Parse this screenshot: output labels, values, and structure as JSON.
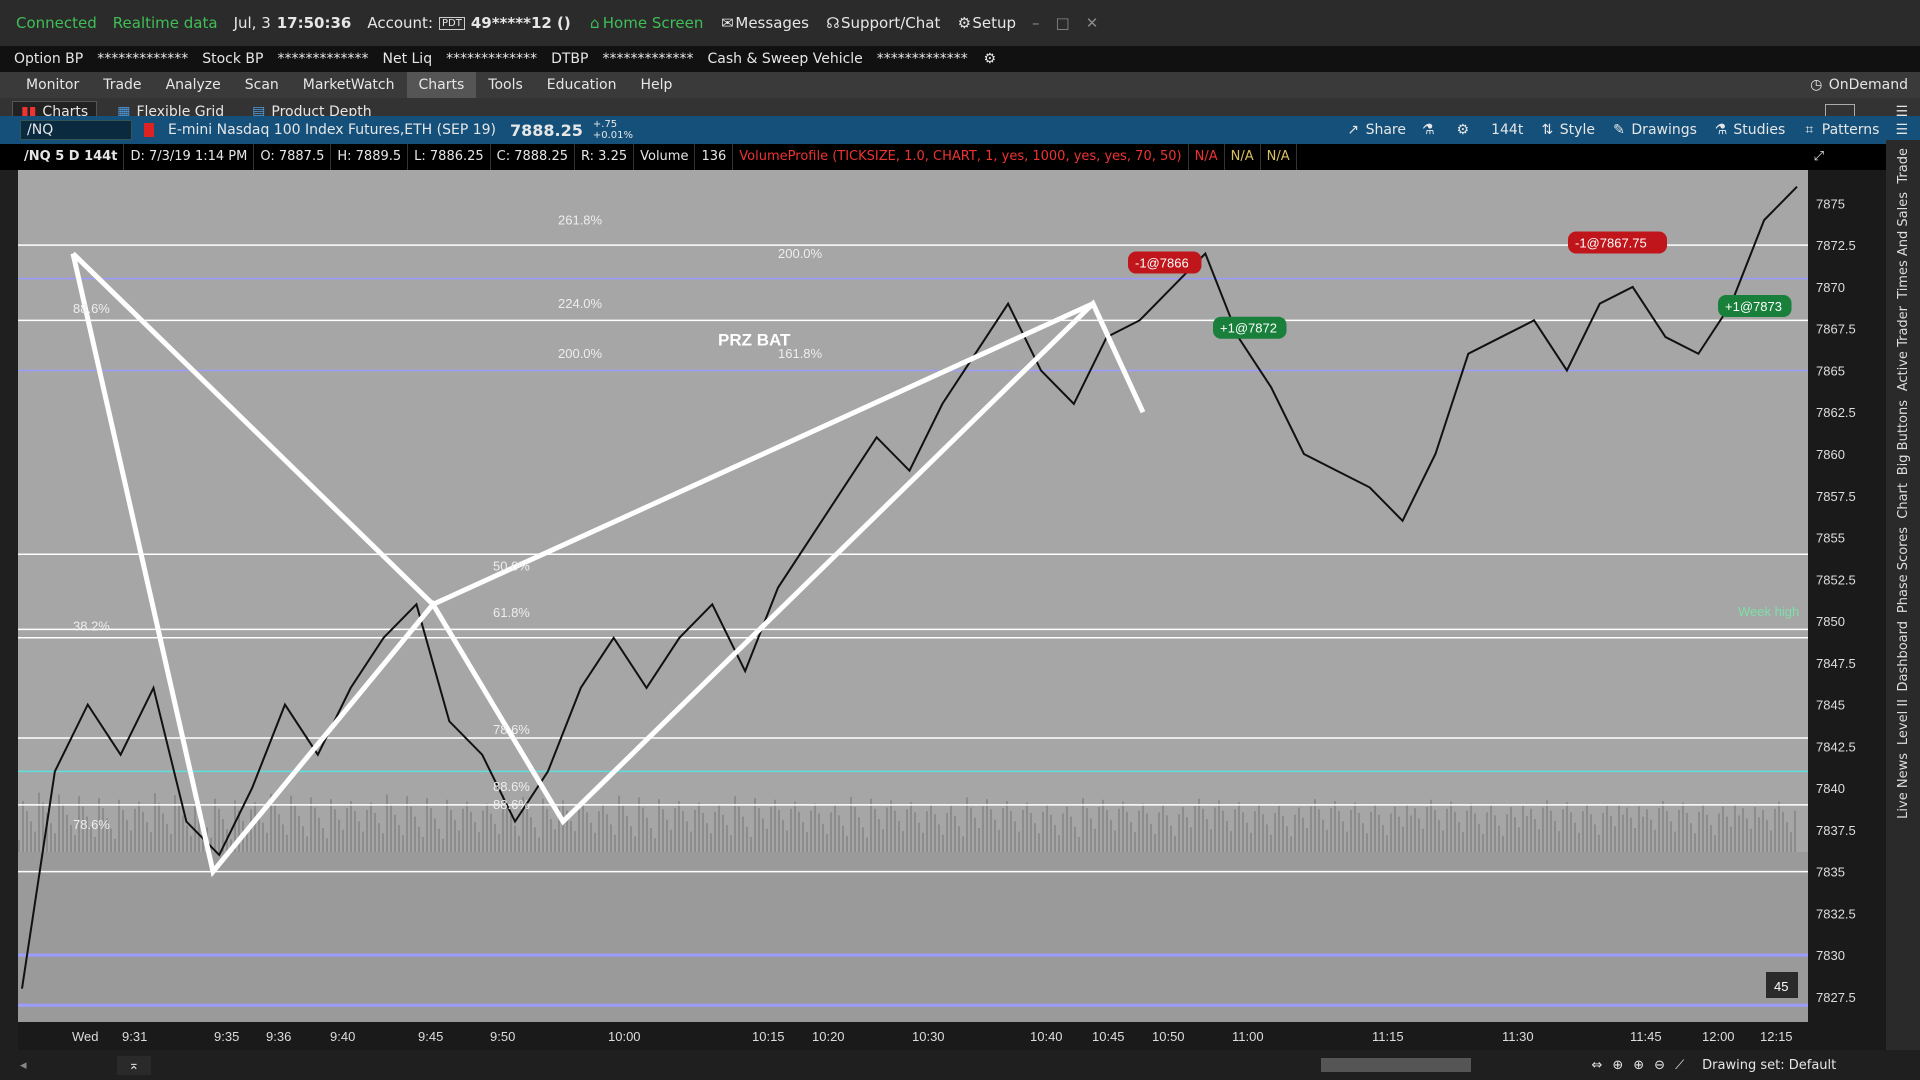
{
  "status": {
    "connected": "Connected",
    "realtime": "Realtime data",
    "date": "Jul, 3",
    "time": "17:50:36",
    "account_label": "Account:",
    "account_badge": "PDT",
    "account_value": "49*****12 ()",
    "home": "Home Screen",
    "messages": "Messages",
    "support": "Support/Chat",
    "setup": "Setup"
  },
  "account_bar": {
    "option_bp": "Option BP",
    "option_bp_val": "*************",
    "stock_bp": "Stock BP",
    "stock_bp_val": "*************",
    "net_liq": "Net Liq",
    "net_liq_val": "*************",
    "dtbp": "DTBP",
    "dtbp_val": "*************",
    "cash": "Cash & Sweep Vehicle",
    "cash_val": "*************"
  },
  "menu": {
    "items": [
      "Monitor",
      "Trade",
      "Analyze",
      "Scan",
      "MarketWatch",
      "Charts",
      "Tools",
      "Education",
      "Help"
    ],
    "ondemand": "OnDemand"
  },
  "subtabs": [
    "Charts",
    "Flexible Grid",
    "Product Depth"
  ],
  "symbol_bar": {
    "symbol": "/NQ",
    "description": "E-mini Nasdaq 100 Index Futures,ETH (SEP 19)",
    "last": "7888.25",
    "change": "+.75",
    "change_pct": "+0.01%",
    "share": "Share",
    "aggregation": "144t",
    "style": "Style",
    "drawings": "Drawings",
    "studies": "Studies",
    "patterns": "Patterns"
  },
  "info_bar": {
    "head": "/NQ 5 D 144t",
    "date": "D: 7/3/19 1:14 PM",
    "open": "O: 7887.5",
    "high": "H: 7889.5",
    "low": "L: 7886.25",
    "close": "C: 7888.25",
    "range": "R: 3.25",
    "volume_label": "Volume",
    "volume_val": "136",
    "vp": "VolumeProfile (TICKSIZE, 1.0, CHART, 1, yes, 1000, yes, yes, 70, 50)",
    "na1": "N/A",
    "na2": "N/A",
    "na3": "N/A"
  },
  "chart_data": {
    "type": "line",
    "title": "",
    "ylim": [
      7826,
      7877
    ],
    "y_ticks": [
      "7875",
      "7872.5",
      "7870",
      "7867.5",
      "7865",
      "7862.5",
      "7860",
      "7857.5",
      "7855",
      "7852.5",
      "7850",
      "7847.5",
      "7845",
      "7842.5",
      "7840",
      "7837.5",
      "7835",
      "7832.5",
      "7830",
      "7827.5"
    ],
    "x_ticks": [
      "Wed",
      "9:31",
      "9:35",
      "9:36",
      "9:40",
      "9:45",
      "9:50",
      "10:00",
      "10:15",
      "10:20",
      "10:30",
      "10:40",
      "10:45",
      "10:50",
      "11:00",
      "11:15",
      "11:30",
      "11:45",
      "12:00",
      "12:15"
    ],
    "fib_labels": [
      "261.8%",
      "200.0%",
      "224.0%",
      "200.0%",
      "161.8%",
      "88.6%",
      "50.0%",
      "61.8%",
      "38.2%",
      "78.6%",
      "78.6%",
      "88.6%",
      "88.6%"
    ],
    "pattern_label": "PRZ BAT",
    "week_high": "Week high",
    "trades": [
      "-1@7866",
      "+1@7872",
      "-1@7867.75",
      "+1@7873"
    ],
    "price_series": [
      7828,
      7841,
      7845,
      7842,
      7846,
      7838,
      7836,
      7840,
      7845,
      7842,
      7846,
      7849,
      7851,
      7844,
      7842,
      7838,
      7841,
      7846,
      7849,
      7846,
      7849,
      7851,
      7847,
      7852,
      7855,
      7858,
      7861,
      7859,
      7863,
      7866,
      7869,
      7865,
      7863,
      7867,
      7868,
      7870,
      7872,
      7867,
      7864,
      7860,
      7859,
      7858,
      7856,
      7860,
      7866,
      7867,
      7868,
      7865,
      7869,
      7870,
      7867,
      7866,
      7869,
      7874,
      7876
    ],
    "harmonic_points": [
      7872,
      7835,
      7851,
      7838,
      7869,
      7862.5
    ],
    "horizontal_levels": [
      7872.5,
      7870.5,
      7868,
      7865,
      7854,
      7849.5,
      7849,
      7843,
      7841,
      7839,
      7835,
      7830,
      7827
    ],
    "corner_badge": "45"
  },
  "bottom": {
    "drawing_set": "Drawing set: Default"
  },
  "side_tabs": [
    "Trade",
    "Times And Sales",
    "Active Trader",
    "Big Buttons",
    "Chart",
    "Phase Scores",
    "Dashboard",
    "Level II",
    "Live News"
  ],
  "colors": {
    "chart_bg": "#a6a6a6",
    "sell_marker": "#c0151b",
    "buy_marker": "#18803a",
    "fib_line": "#8a8aff"
  }
}
